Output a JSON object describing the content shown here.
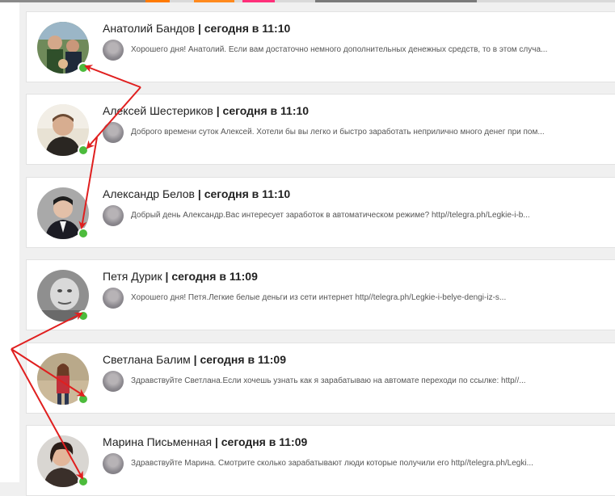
{
  "colors": {
    "background": "#f0f0f0",
    "card": "#ffffff",
    "online_indicator": "#4cbb3c",
    "annotation_arrow": "#e01f1f"
  },
  "conversations": [
    {
      "name_line": "Анатолий Бандов | сегодня в 11:10",
      "preview": "Хорошего дня! Анатолий. Если вам достаточно немного дополнительных денежных средств, то в этом случа...",
      "online": true
    },
    {
      "name_line": "Алексей Шестериков | сегодня в 11:10",
      "preview": "Доброго времени суток Алексей. Хотели бы вы легко и быстро заработать неприлично много денег при пом...",
      "online": true
    },
    {
      "name_line": "Александр Белов | сегодня в 11:10",
      "preview": "Добрый день Александр.Вас интересует заработок в автоматическом режиме? http//telegra.ph/Legkie-i-b...",
      "online": true
    },
    {
      "name_line": "Петя Дурик | сегодня в 11:09",
      "preview": "Хорошего дня! Петя.Легкие белые деньги из сети интернет http//telegra.ph/Legkie-i-belye-dengi-iz-s...",
      "online": true
    },
    {
      "name_line": "Светлана Балим | сегодня в 11:09",
      "preview": "Здравствуйте Светлана.Если хочешь узнать как я зарабатываю на автомате переходи по ссылке: http//...",
      "online": true
    },
    {
      "name_line": "Марина Письменная | сегодня в 11:09",
      "preview": "Здравствуйте Марина. Смотрите сколько зарабатывают люди которые получили его http//telegra.ph/Legki...",
      "online": true
    }
  ]
}
